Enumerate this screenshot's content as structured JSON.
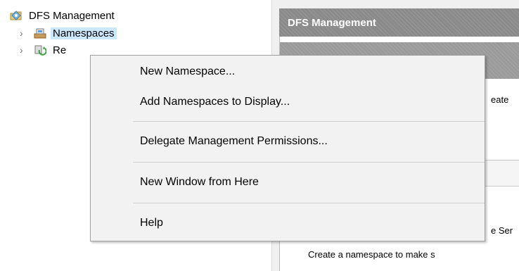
{
  "tree": {
    "root": {
      "label": "DFS Management",
      "icon": "dfs-management-icon"
    },
    "items": [
      {
        "label": "Namespaces",
        "icon": "namespaces-icon",
        "selected": true
      },
      {
        "label": "Re",
        "icon": "replication-icon",
        "selected": false
      }
    ]
  },
  "right_pane": {
    "header": "DFS Management",
    "partial_text_1": "eate",
    "partial_text_2": "e Ser",
    "partial_text_3": "Create a namespace to make s"
  },
  "context_menu": {
    "items": [
      {
        "label": "New Namespace..."
      },
      {
        "label": "Add Namespaces to Display..."
      },
      {
        "label": "Delegate Management Permissions..."
      },
      {
        "label": "New Window from Here"
      },
      {
        "label": "Help"
      }
    ]
  },
  "colors": {
    "selection": "#cce8ff",
    "menu_background": "#f2f2f2",
    "header_background": "#8a8a8a"
  }
}
